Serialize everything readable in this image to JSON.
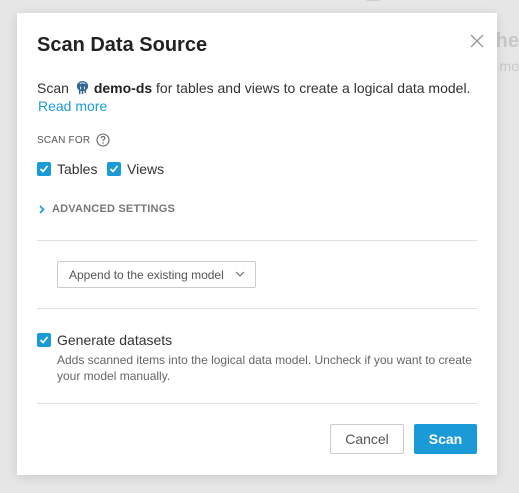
{
  "background": {
    "partial_heading": "the",
    "partial_subtext": "mo"
  },
  "dialog": {
    "title": "Scan Data Source",
    "description_prefix": "Scan",
    "datasource_name": "demo-ds",
    "datasource_icon": "postgresql-elephant-icon",
    "description_suffix": "for tables and views to create a logical data model.",
    "read_more": "Read more",
    "scan_for_label": "SCAN FOR",
    "scan_for_options": [
      {
        "label": "Tables",
        "checked": true
      },
      {
        "label": "Views",
        "checked": true
      }
    ],
    "advanced_settings": "ADVANCED SETTINGS",
    "model_option_selected": "Append to the existing model",
    "generate_datasets": {
      "label": "Generate datasets",
      "checked": true,
      "help": "Adds scanned items into the logical data model. Uncheck if you want to create your model manually."
    },
    "cancel_label": "Cancel",
    "scan_label": "Scan"
  },
  "colors": {
    "accent": "#1a9bd7",
    "overlay": "#e6e6e6"
  }
}
